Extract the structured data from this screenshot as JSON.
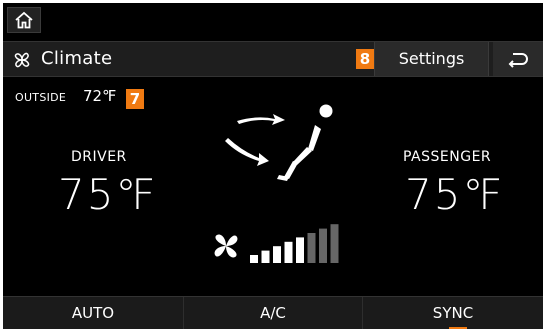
{
  "header": {
    "title": "Climate",
    "badge_8": "8",
    "settings_label": "Settings"
  },
  "outside": {
    "label": "OUTSIDE",
    "temp": "72℉",
    "badge_7": "7"
  },
  "driver": {
    "label": "DRIVER",
    "temp": "75℉"
  },
  "passenger": {
    "label": "PASSENGER",
    "temp": "75℉"
  },
  "fan": {
    "speed_level": 5,
    "max_level": 8
  },
  "bottom": {
    "auto_label": "AUTO",
    "ac_label": "A/C",
    "sync_label": "SYNC"
  },
  "colors": {
    "accent": "#f07a12",
    "background": "#000000",
    "bar_active": "#ffffff",
    "bar_inactive": "#666666"
  },
  "icons": [
    "home-icon",
    "fan-icon",
    "back-arrow-icon",
    "airflow-seat-icon"
  ]
}
